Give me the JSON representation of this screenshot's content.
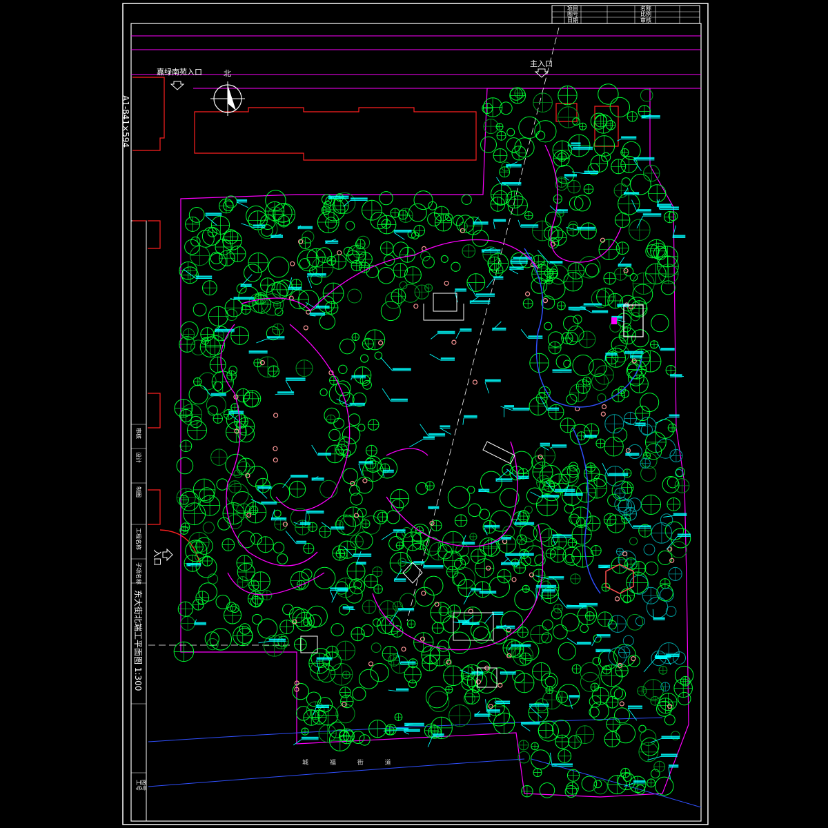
{
  "drawing": {
    "sheet_size_note": "A1-841×594",
    "north_label": "北",
    "entrances": {
      "main": "主入口",
      "north_side": "嘉绿南苑入口",
      "west": "入口"
    },
    "road_label": "城 福 街 道",
    "side_title": "东大街北端工平面图 1:300",
    "title_block_top": [
      "项目",
      "图号",
      "日期",
      "名称",
      "比例",
      "审核"
    ],
    "title_block_side": [
      "审核",
      "设计",
      "制图",
      "工程名称",
      "子项名称",
      "图号"
    ],
    "bottom_stamp": [
      "工号",
      "图号"
    ],
    "colors": {
      "frame": "#ffffff",
      "boundary": "#ff00ff",
      "building": "#ff2020",
      "path": "#ff00ff",
      "trees": "#00ff33",
      "tree_dark": "#00a020",
      "labels": "#00ffff",
      "water_edge": "#3050ff",
      "teal_trees": "#00a0a0",
      "flower": "#ff9999"
    }
  }
}
